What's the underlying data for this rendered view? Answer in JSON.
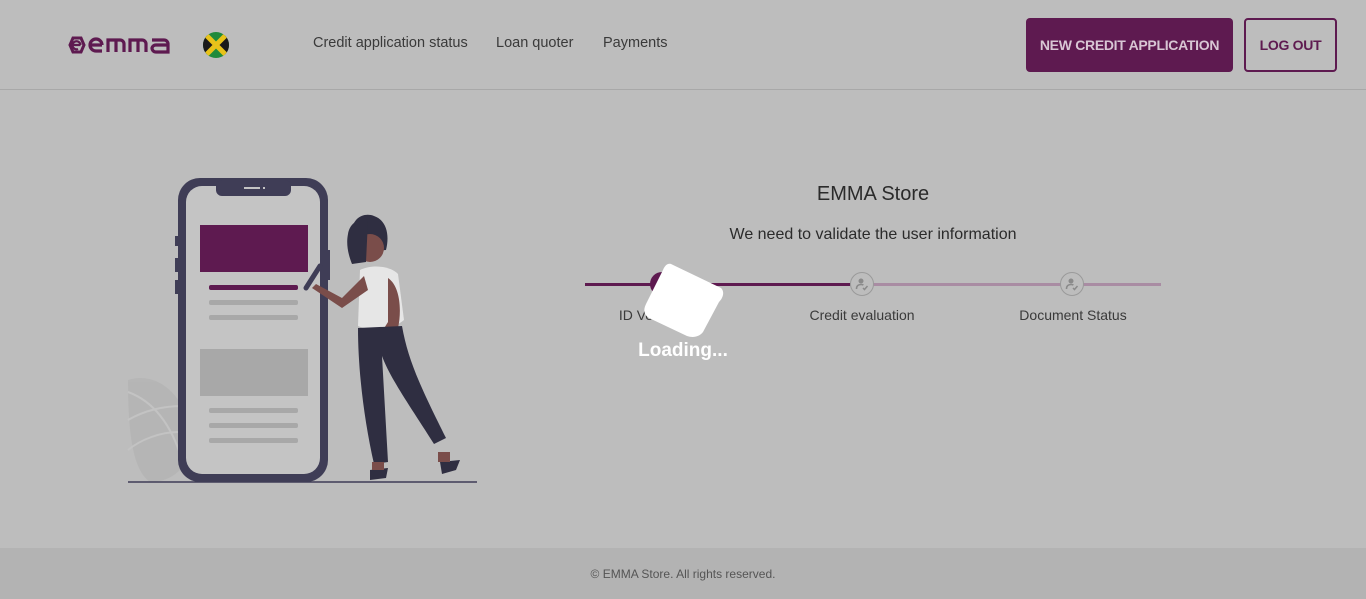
{
  "header": {
    "logo_text": "emma",
    "flag": "jamaica-flag",
    "nav": [
      {
        "label": "Credit application status"
      },
      {
        "label": "Loan quoter"
      },
      {
        "label": "Payments"
      }
    ],
    "new_credit_label": "NEW CREDIT APPLICATION",
    "logout_label": "LOG OUT"
  },
  "main": {
    "store_title": "EMMA Store",
    "subtitle": "We need to validate the user information",
    "steps": [
      {
        "label": "ID Verification",
        "state": "active",
        "icon": "user-check-icon"
      },
      {
        "label": "Credit evaluation",
        "state": "pending",
        "icon": "user-check-icon"
      },
      {
        "label": "Document Status",
        "state": "pending",
        "icon": "user-check-icon"
      }
    ],
    "loading_text": "Loading..."
  },
  "footer": {
    "copyright": "© EMMA Store. All rights reserved."
  },
  "colors": {
    "brand": "#5e1a50",
    "brand_light": "#a98ca3",
    "background": "#bdbdbd",
    "footer_bg": "#b3b3b3"
  }
}
